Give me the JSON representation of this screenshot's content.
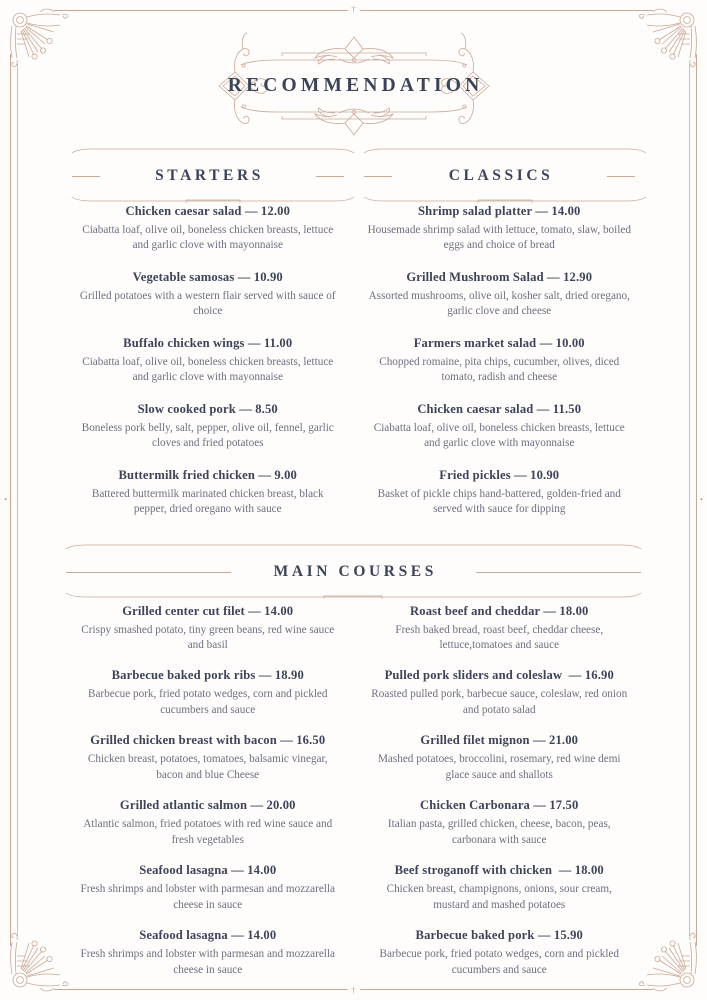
{
  "title": "RECOMMENDATION",
  "colors": {
    "ornament": "#c9a896",
    "heading": "#3d4458",
    "description": "#6c6f80",
    "background": "#fefdfc"
  },
  "sections": [
    {
      "id": "starters",
      "heading": "STARTERS",
      "items": [
        {
          "name": "Chicken caesar salad — 12.00",
          "desc": "Ciabatta loaf, olive oil, boneless chicken breasts, lettuce and garlic clove with mayonnaise"
        },
        {
          "name": "Vegetable samosas — 10.90",
          "desc": "Grilled potatoes with a western flair served with sauce of choice"
        },
        {
          "name": "Buffalo chicken wings — 11.00",
          "desc": "Ciabatta loaf, olive oil, boneless chicken breasts, lettuce and garlic clove with mayonnaise"
        },
        {
          "name": "Slow cooked pork — 8.50",
          "desc": "Boneless  pork belly, salt, pepper, olive oil, fennel, garlic cloves and fried potatoes"
        },
        {
          "name": "Buttermilk fried chicken — 9.00",
          "desc": "Battered buttermilk marinated chicken breast, black pepper, dried oregano with sauce"
        }
      ]
    },
    {
      "id": "classics",
      "heading": "CLASSICS",
      "items": [
        {
          "name": "Shrimp salad platter — 14.00",
          "desc": "Housemade shrimp salad with lettuce, tomato, slaw, boiled eggs and choice of bread"
        },
        {
          "name": "Grilled Mushroom Salad — 12.90",
          "desc": "Assorted mushrooms, olive oil, kosher salt, dried oregano, garlic clove and cheese"
        },
        {
          "name": "Farmers market salad — 10.00",
          "desc": "Chopped romaine, pita chips, cucumber, olives, diced tomato, radish and cheese"
        },
        {
          "name": "Chicken caesar salad — 11.50",
          "desc": "Ciabatta loaf, olive oil, boneless chicken breasts, lettuce and garlic clove with mayonnaise"
        },
        {
          "name": "Fried pickles — 10.90",
          "desc": "Basket of pickle chips hand-battered, golden-fried and served with sauce for dipping"
        }
      ]
    }
  ],
  "main_courses": {
    "heading": "MAIN COURSES",
    "left_items": [
      {
        "name": "Grilled center cut filet — 14.00",
        "desc": "Crispy smashed potato, tiny green beans, red wine sauce and basil"
      },
      {
        "name": "Barbecue baked pork ribs — 18.90",
        "desc": "Barbecue pork, fried potato wedges, corn and pickled cucumbers and sauce"
      },
      {
        "name": "Grilled chicken breast with bacon — 16.50",
        "desc": "Chicken breast, potatoes, tomatoes, balsamic vinegar, bacon and blue Cheese"
      },
      {
        "name": "Grilled atlantic salmon — 20.00",
        "desc": "Atlantic salmon, fried potatoes with red wine sauce and fresh vegetables"
      },
      {
        "name": "Seafood lasagna — 14.00",
        "desc": "Fresh shrimps and lobster with parmesan and mozzarella cheese in sauce"
      },
      {
        "name": "Seafood lasagna — 14.00",
        "desc": "Fresh shrimps and lobster with parmesan and mozzarella cheese in sauce"
      }
    ],
    "right_items": [
      {
        "name": "Roast beef and cheddar — 18.00",
        "desc": "Fresh baked bread, roast beef, cheddar cheese, lettuce,tomatoes and sauce"
      },
      {
        "name": "Pulled pork sliders and coleslaw  — 16.90",
        "desc": "Roasted pulled pork, barbecue sauce, coleslaw, red onion and potato salad"
      },
      {
        "name": "Grilled filet mignon — 21.00",
        "desc": "Mashed potatoes, broccolini, rosemary, red wine demi glace sauce and shallots"
      },
      {
        "name": "Chicken Carbonara — 17.50",
        "desc": "Italian pasta, grilled chicken, cheese, bacon, peas, carbonara with sauce"
      },
      {
        "name": "Beef stroganoff with chicken  — 18.00",
        "desc": "Chicken breast, champignons, onions, sour cream, mustard and mashed potatoes"
      },
      {
        "name": "Barbecue baked pork — 15.90",
        "desc": "Barbecue pork, fried potato wedges, corn and pickled cucumbers and sauce"
      }
    ]
  }
}
